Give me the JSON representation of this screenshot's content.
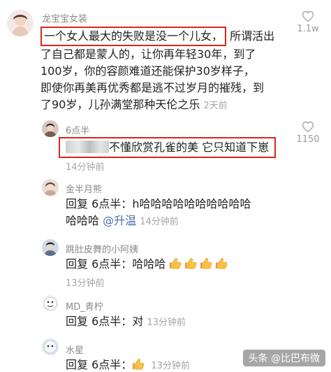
{
  "comments": [
    {
      "user": "龙宝宝女装",
      "boxed_text": "一个女人最大的失败是没一个儿女，",
      "text_rest": "所谓活出",
      "lines": [
        "了自己都是蒙人的，让你再年轻30年，到了",
        "100岁，你的容颜难道还能保护30岁样子，",
        "即使你再美再优秀都是逃不过岁月的摧残，到"
      ],
      "last_line": "了90岁，儿孙满堂那种天伦之乐",
      "time": "2天前",
      "likes": "1.1w"
    },
    {
      "user": "6点半",
      "boxed_text": "不懂欣赏孔雀的美 它只知道下崽",
      "time": "14分钟前",
      "likes": "1150"
    },
    {
      "user": "金半月熊",
      "reply_prefix": "回复",
      "reply_to": "6点半",
      "text": "h哈哈哈哈哈哈哈哈哈哈",
      "text_line2": "哈哈哈",
      "mention": "@升温",
      "time": "14分钟前"
    },
    {
      "user": "跳肚皮舞的小阿姨",
      "reply_prefix": "回复",
      "reply_to": "6点半",
      "text": "哈哈哈",
      "thumbs_count": 4,
      "time": "13分钟前"
    },
    {
      "user": "MD_青柠",
      "reply_prefix": "回复",
      "reply_to": "6点半",
      "text": "对",
      "time": "13分钟前"
    },
    {
      "user": "水星",
      "reply_prefix": "回复",
      "reply_to": "6点半",
      "thumbs_count": 1,
      "time": "13分钟前"
    }
  ],
  "watermark": "头条 @比巴布微"
}
